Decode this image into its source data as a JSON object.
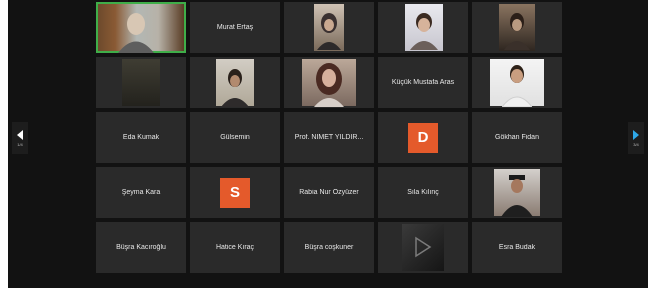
{
  "nav": {
    "prev_label": "1/4",
    "next_label": "3/4"
  },
  "colors": {
    "accent_orange": "#e45a2b",
    "active_speaker": "#3fae49",
    "tile_bg": "#2a2a2a"
  },
  "participants": [
    {
      "type": "video",
      "desc": "older man, bookshelf background",
      "active": true
    },
    {
      "type": "name",
      "name": "Murat Ertaş"
    },
    {
      "type": "video",
      "desc": "woman with headscarf"
    },
    {
      "type": "video",
      "desc": "young person, bright room"
    },
    {
      "type": "video",
      "desc": "young person, dim room"
    },
    {
      "type": "video",
      "desc": "blurred dark video"
    },
    {
      "type": "video",
      "desc": "young man, wall background"
    },
    {
      "type": "video",
      "desc": "young woman, long hair"
    },
    {
      "type": "name",
      "name": "Küçük Mustafa Aras"
    },
    {
      "type": "video",
      "desc": "man with beard, white background"
    },
    {
      "type": "name",
      "name": "Eda Kumak"
    },
    {
      "type": "name",
      "name": "Gülsemin"
    },
    {
      "type": "name",
      "name": "Prof. NİMET YILDIR..."
    },
    {
      "type": "avatar",
      "letter": "D"
    },
    {
      "type": "name",
      "name": "Gökhan Fidan"
    },
    {
      "type": "name",
      "name": "Şeyma Kara"
    },
    {
      "type": "avatar",
      "letter": "S"
    },
    {
      "type": "name",
      "name": "Rabia Nur Özyüzer"
    },
    {
      "type": "name",
      "name": "Sıla Kılınç"
    },
    {
      "type": "video",
      "desc": "person with hat, arms crossed"
    },
    {
      "type": "name",
      "name": "Büşra Kacıroğlu"
    },
    {
      "type": "name",
      "name": "Hatice Kıraç"
    },
    {
      "type": "name",
      "name": "Büşra coşkuner"
    },
    {
      "type": "video",
      "desc": "dark screen with play icon"
    },
    {
      "type": "name",
      "name": "Esra Budak"
    }
  ]
}
